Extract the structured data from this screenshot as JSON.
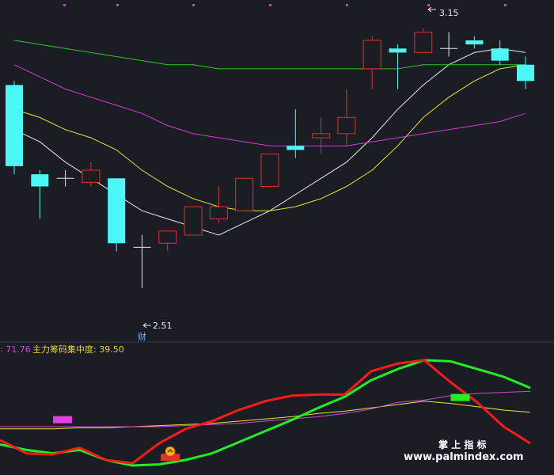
{
  "colors": {
    "background": "#1b1d24",
    "up": "#e0312b",
    "down": "#4ef7f7",
    "ma_white": "#e8e8e8",
    "ma_yellow": "#e8e23a",
    "ma_magenta": "#d43ad4",
    "ma_green": "#2ec42e",
    "ind_red": "#ff1a1a",
    "ind_green": "#22ee22",
    "ind_magenta": "#d04ad0",
    "ind_yellow": "#e8e23a",
    "divider": "#3a3d47",
    "label_red": "#ff2020",
    "label_yellow": "#f0d030",
    "label_magenta": "#e040e0"
  },
  "chart_data": [
    {
      "type": "candlestick",
      "ylim": [
        2.4,
        3.2
      ],
      "annotations": {
        "high_label": "3.15",
        "low_label": "2.51",
        "marker_text": "财"
      },
      "candles": [
        {
          "o": 3.01,
          "h": 3.02,
          "l": 2.79,
          "c": 2.81
        },
        {
          "o": 2.79,
          "h": 2.8,
          "l": 2.68,
          "c": 2.76
        },
        {
          "o": 2.78,
          "h": 2.8,
          "l": 2.76,
          "c": 2.78
        },
        {
          "o": 2.77,
          "h": 2.82,
          "l": 2.76,
          "c": 2.8
        },
        {
          "o": 2.78,
          "h": 2.78,
          "l": 2.6,
          "c": 2.62
        },
        {
          "o": 2.61,
          "h": 2.64,
          "l": 2.51,
          "c": 2.61
        },
        {
          "o": 2.62,
          "h": 2.65,
          "l": 2.6,
          "c": 2.65
        },
        {
          "o": 2.64,
          "h": 2.7,
          "l": 2.64,
          "c": 2.71
        },
        {
          "o": 2.68,
          "h": 2.76,
          "l": 2.67,
          "c": 2.71
        },
        {
          "o": 2.7,
          "h": 2.78,
          "l": 2.7,
          "c": 2.78
        },
        {
          "o": 2.76,
          "h": 2.84,
          "l": 2.76,
          "c": 2.84
        },
        {
          "o": 2.86,
          "h": 2.95,
          "l": 2.83,
          "c": 2.85
        },
        {
          "o": 2.88,
          "h": 2.93,
          "l": 2.84,
          "c": 2.89
        },
        {
          "o": 2.89,
          "h": 3.0,
          "l": 2.86,
          "c": 2.93
        },
        {
          "o": 3.05,
          "h": 3.13,
          "l": 3.0,
          "c": 3.12
        },
        {
          "o": 3.1,
          "h": 3.11,
          "l": 3.0,
          "c": 3.09
        },
        {
          "o": 3.09,
          "h": 3.15,
          "l": 3.09,
          "c": 3.14
        },
        {
          "o": 3.1,
          "h": 3.14,
          "l": 3.08,
          "c": 3.1
        },
        {
          "o": 3.12,
          "h": 3.13,
          "l": 3.1,
          "c": 3.11
        },
        {
          "o": 3.1,
          "h": 3.12,
          "l": 3.06,
          "c": 3.07
        },
        {
          "o": 3.06,
          "h": 3.08,
          "l": 3.0,
          "c": 3.02
        }
      ],
      "series": [
        {
          "color_key": "ma_white",
          "values": [
            2.9,
            2.87,
            2.82,
            2.78,
            2.74,
            2.7,
            2.68,
            2.66,
            2.64,
            2.67,
            2.7,
            2.74,
            2.78,
            2.82,
            2.88,
            2.95,
            3.01,
            3.06,
            3.09,
            3.1,
            3.09
          ]
        },
        {
          "color_key": "ma_yellow",
          "values": [
            2.95,
            2.93,
            2.9,
            2.88,
            2.85,
            2.8,
            2.76,
            2.73,
            2.71,
            2.7,
            2.7,
            2.71,
            2.73,
            2.76,
            2.8,
            2.86,
            2.93,
            2.98,
            3.02,
            3.05,
            3.06
          ]
        },
        {
          "color_key": "ma_magenta",
          "values": [
            3.06,
            3.03,
            3.0,
            2.98,
            2.96,
            2.94,
            2.91,
            2.89,
            2.88,
            2.87,
            2.86,
            2.86,
            2.86,
            2.86,
            2.87,
            2.88,
            2.89,
            2.9,
            2.91,
            2.92,
            2.94
          ]
        },
        {
          "color_key": "ma_green",
          "values": [
            3.12,
            3.11,
            3.1,
            3.09,
            3.08,
            3.07,
            3.06,
            3.06,
            3.05,
            3.05,
            3.05,
            3.05,
            3.05,
            3.05,
            3.05,
            3.05,
            3.06,
            3.06,
            3.06,
            3.06,
            3.06
          ]
        }
      ]
    },
    {
      "type": "line",
      "legend": [
        {
          "text": ": 71.76",
          "color_key": "label_magenta"
        },
        {
          "text": "主力筹码集中度: 39.50",
          "color_key": "label_yellow"
        }
      ],
      "ylim": [
        0,
        100
      ],
      "series": [
        {
          "color_key": "ind_red",
          "values": [
            28,
            16,
            15,
            21,
            10,
            7,
            25,
            38,
            45,
            55,
            63,
            68,
            69,
            69,
            90,
            97,
            100,
            80,
            62,
            40,
            25
          ]
        },
        {
          "color_key": "ind_green",
          "values": [
            24,
            19,
            16,
            19,
            10,
            5,
            6,
            10,
            16,
            26,
            36,
            46,
            57,
            67,
            82,
            92,
            100,
            99,
            92,
            85,
            75
          ]
        },
        {
          "color_key": "ind_magenta",
          "values": [
            40,
            40,
            40,
            40,
            40,
            40,
            40,
            41,
            42,
            43,
            45,
            47,
            49,
            52,
            56,
            62,
            64,
            68,
            70,
            71,
            72
          ]
        },
        {
          "color_key": "ind_yellow",
          "values": [
            38,
            38,
            38,
            39,
            39,
            40,
            41,
            42,
            43,
            45,
            47,
            49,
            52,
            54,
            57,
            60,
            63,
            61,
            58,
            55,
            53
          ]
        }
      ],
      "markers": [
        {
          "index": 2,
          "value": 46,
          "color_key": "label_magenta"
        },
        {
          "index": 6,
          "value": 12,
          "color_key": "up"
        },
        {
          "index": 17,
          "value": 66,
          "color_key": "ind_green"
        }
      ]
    }
  ],
  "watermark": {
    "title": "掌 上 指 标",
    "url": "www.palmindex.com"
  }
}
